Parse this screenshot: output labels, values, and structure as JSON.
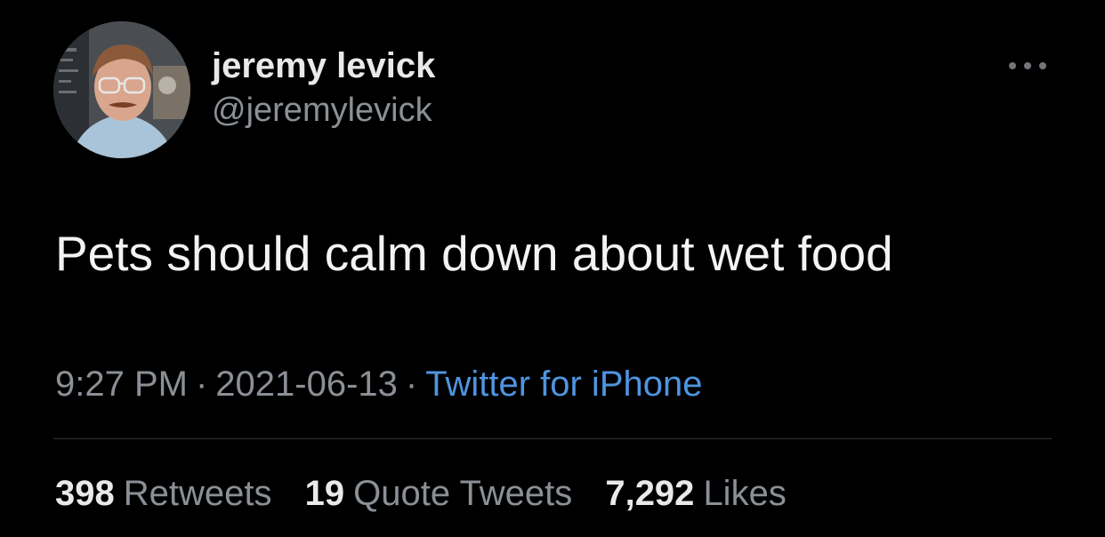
{
  "author": {
    "display_name": "jeremy levick",
    "handle": "@jeremylevick",
    "avatar_icon": "profile-photo"
  },
  "tweet": {
    "text": "Pets should calm down about wet food"
  },
  "meta": {
    "time": "9:27 PM",
    "separator": "·",
    "date": "2021-06-13",
    "source": "Twitter for iPhone"
  },
  "stats": {
    "retweets": {
      "count": "398",
      "label": "Retweets"
    },
    "quote_tweets": {
      "count": "19",
      "label": "Quote Tweets"
    },
    "likes": {
      "count": "7,292",
      "label": "Likes"
    }
  },
  "menu": {
    "more_icon": "ellipsis-icon"
  },
  "colors": {
    "background": "#000000",
    "primary_text": "#e7e9ea",
    "secondary_text": "#8b9096",
    "link": "#4f94e0",
    "divider": "#2f3336"
  }
}
